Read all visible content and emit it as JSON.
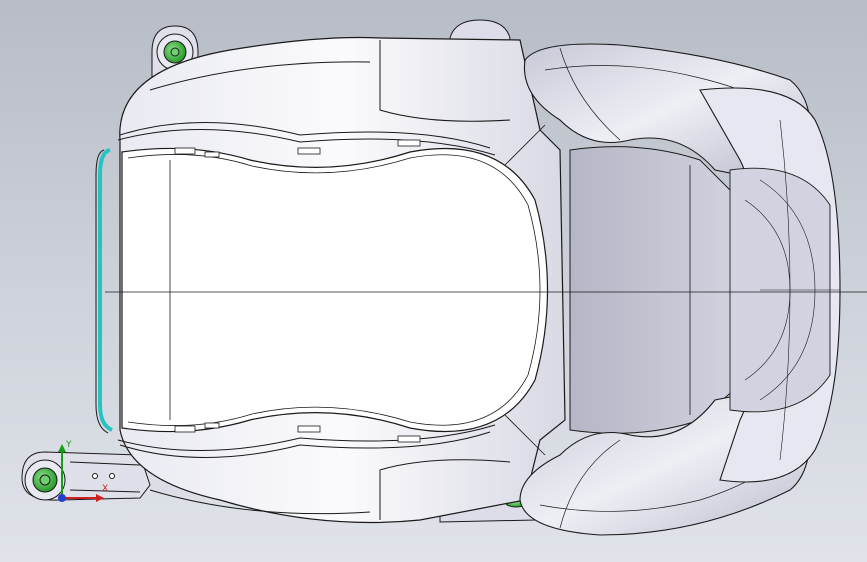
{
  "app": {
    "window_title": "",
    "view": "top",
    "display_style": "shaded with edges"
  },
  "model": {
    "part": "seat-shell",
    "mount_points": 4
  },
  "triad": {
    "x_label": "X",
    "y_label": "Y"
  },
  "colors": {
    "background_top": "#b7bcc6",
    "background_bottom": "#e0e3ea",
    "part_fill": "#f6f7fb",
    "part_shade": "#c9cad6",
    "edge": "#1a1a1a",
    "selected_edge": "#27c2c2",
    "mount_green": "#3fb83f"
  }
}
